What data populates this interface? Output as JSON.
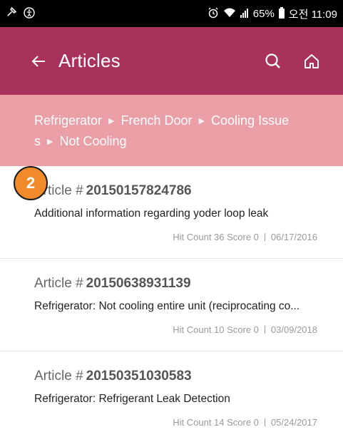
{
  "status_bar": {
    "battery_percent": "65%",
    "time": "오전 11:09",
    "icons": [
      "pin-icon",
      "accessibility-icon",
      "alarm-icon",
      "wifi-icon",
      "signal-icon",
      "battery-icon"
    ]
  },
  "app_bar": {
    "title": "Articles",
    "back_icon": "arrow-left-icon",
    "search_icon": "search-icon",
    "home_icon": "home-icon",
    "background": "#a8325b"
  },
  "breadcrumb": {
    "items": [
      {
        "label": "Refrigerator"
      },
      {
        "label": "French Door"
      },
      {
        "label": "Cooling Issue"
      },
      {
        "label": "s"
      },
      {
        "label": "Not Cooling"
      }
    ],
    "background": "#ea9ea5"
  },
  "marker": {
    "label": "2",
    "color": "#f08a2a"
  },
  "articles": [
    {
      "prefix": "Article #",
      "number": "20150157824786",
      "description": "Additional information regarding yoder loop leak",
      "hit_count": "Hit Count 36 Score 0",
      "date": "06/17/2016"
    },
    {
      "prefix": "Article #",
      "number": "20150638931139",
      "description": "Refrigerator: Not cooling entire unit (reciprocating co...",
      "hit_count": "Hit Count 10 Score 0",
      "date": "03/09/2018"
    },
    {
      "prefix": "Article #",
      "number": "20150351030583",
      "description": "Refrigerator: Refrigerant Leak Detection",
      "hit_count": "Hit Count 14 Score 0",
      "date": "05/24/2017"
    }
  ]
}
